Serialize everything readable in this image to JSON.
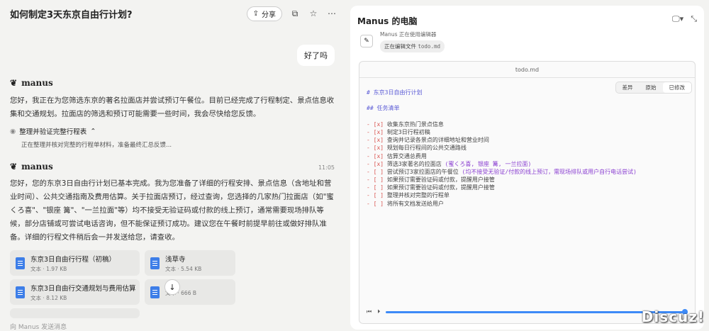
{
  "header": {
    "title": "如何制定3天东京自由行计划?",
    "share_label": "分享"
  },
  "user_message": "好了吗",
  "assistant": {
    "name": "manus",
    "message1": "您好，我正在为您筛选东京的著名拉面店并尝试预订午餐位。目前已经完成了行程制定、景点信息收集和交通规划。拉面店的筛选和预订可能需要一些时间，我会尽快给您反馈。",
    "step_title": "整理并验证完整行程表",
    "step_detail": "正在整理并核对完整的行程单材料，准备最终汇总反馈...",
    "time": "11:05",
    "message2": "您好，您的东京3日自由行计划已基本完成。我为您准备了详细的行程安排、景点信息（含地址和营业时间）、公共交通指南及费用估算。关于拉面店预订，经过查询，您选择的几家热门拉面店（如\"蜜くろ喜\"、\"银座 篝\"、\"一兰拉面\"等）均不接受无验证码或付款的线上预订，通常需要现场排队等候，部分店铺或可尝试电话咨询，但不能保证预订成功。建议您在午餐时前提早前往或做好排队准备。详细的行程文件稍后会一并发送给您，请查收。"
  },
  "files": [
    {
      "name": "东京3日自由行行程（初稿）",
      "meta": "文本 · 1.97 KB"
    },
    {
      "name": "浅草寺",
      "meta": "文本 · 5.54 KB"
    },
    {
      "name": "东京3日自由行交通规划与费用估算",
      "meta": "文本 · 8.12 KB"
    },
    {
      "name": "",
      "meta": "文本 · 666 B"
    }
  ],
  "input_placeholder": "向 Manus 发送消息",
  "panel": {
    "title": "Manus 的电脑",
    "status": "Manus 正在使用编辑器",
    "edit_label": "正在编辑文件",
    "edit_file": "todo.md",
    "editor_title": "todo.md",
    "tabs": [
      "差异",
      "原始",
      "已修改"
    ],
    "active_tab": "已修改"
  },
  "code_lines": [
    {
      "text": "# 东京3日自由行计划",
      "kind": "h"
    },
    {
      "text": "",
      "kind": ""
    },
    {
      "text": "## 任务清单",
      "kind": "h"
    },
    {
      "text": "",
      "kind": ""
    },
    {
      "mark": "- [x]",
      "text": " 收集东京热门景点信息"
    },
    {
      "mark": "- [x]",
      "text": " 制定3日行程初稿"
    },
    {
      "mark": "- [x]",
      "text": " 查询并记录各景点的详细地址和营业时间"
    },
    {
      "mark": "- [x]",
      "text": " 规划每日行程间的公共交通路线"
    },
    {
      "mark": "- [x]",
      "text": " 估算交通总费用"
    },
    {
      "mark": "- [x]",
      "text": " 筛选3家著名的拉面店 ",
      "extra": "(蜜くろ喜, 银座 篝, 一兰拉面)"
    },
    {
      "mark": "- [ ]",
      "text": " 尝试预订3家拉面店的午餐位 ",
      "extra": "(均不接受无验证/付款的线上预订，需现场排队或用户自行电话尝试)"
    },
    {
      "mark": "- [ ]",
      "text": " 如果预订需要验证码或付款，提醒用户接管"
    },
    {
      "mark": "- [ ]",
      "text": " 如果预订需要验证码或付款，提醒用户接管"
    },
    {
      "mark": "- [ ]",
      "text": " 整理并核对完整的行程单"
    },
    {
      "mark": "- [ ]",
      "text": " 将所有文档发送给用户"
    }
  ],
  "watermark": "Discuz!"
}
